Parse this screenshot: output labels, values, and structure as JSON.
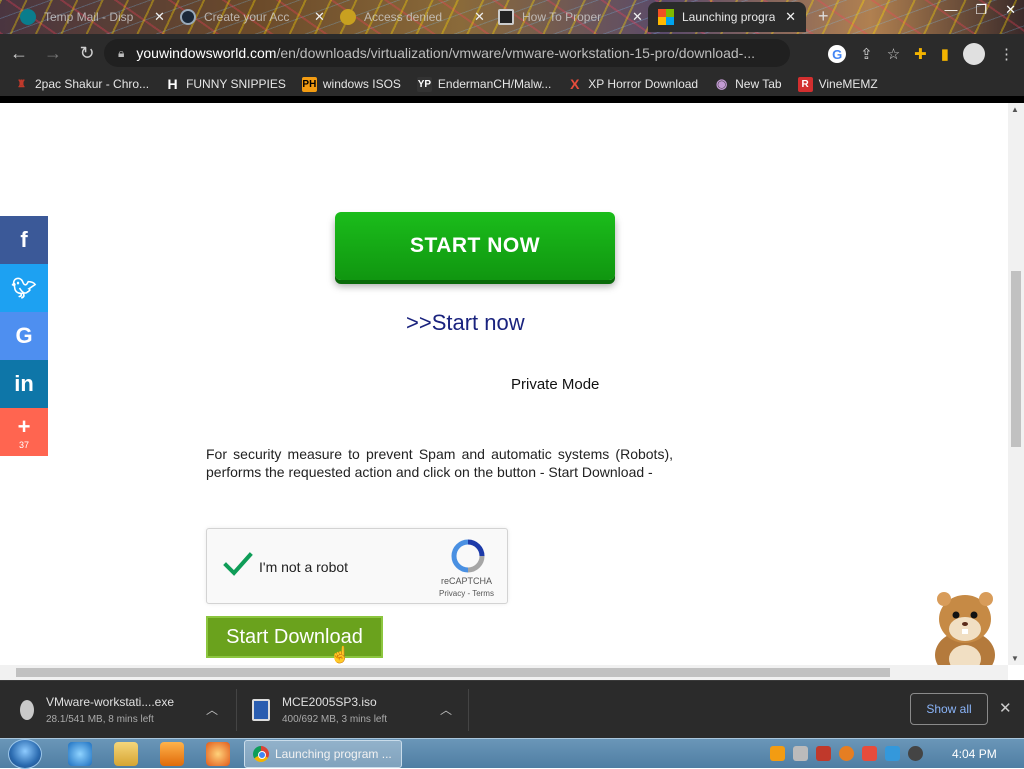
{
  "tabs": [
    {
      "title": "Temp Mail - Disp",
      "favicon_color": "#0a7d8c",
      "active": false
    },
    {
      "title": "Create your Acc",
      "favicon_color": "#1b2838",
      "active": false
    },
    {
      "title": "Access denied",
      "favicon_color": "#c8a020",
      "active": false
    },
    {
      "title": "How To Proper",
      "favicon_color": "#222222",
      "active": false
    },
    {
      "title": "Launching progra",
      "favicon_color": "#f25022",
      "active": true
    }
  ],
  "url": {
    "host": "youwindowsworld.com",
    "path": "/en/downloads/virtualization/vmware/vmware-workstation-15-pro/download-..."
  },
  "bookmarks": [
    {
      "label": "2pac Shakur - Chro...",
      "icon": "gear-icon",
      "color": "#c0392b",
      "glyph": "♜"
    },
    {
      "label": "FUNNY SNIPPIES",
      "icon": "h-logo-icon",
      "color": "#ffffff",
      "glyph": "H"
    },
    {
      "label": "windows ISOS",
      "icon": "ph-logo-icon",
      "color": "#f39c12",
      "glyph": "PH"
    },
    {
      "label": "EndermanCH/Malw...",
      "icon": "yp-logo-icon",
      "color": "#333333",
      "glyph": "YP"
    },
    {
      "label": "XP Horror Download",
      "icon": "x-logo-icon",
      "color": "#e74c3c",
      "glyph": "X"
    },
    {
      "label": "New Tab",
      "icon": "globe-icon",
      "color": "#9b59b6",
      "glyph": "◉"
    },
    {
      "label": "VineMEMZ",
      "icon": "r-logo-icon",
      "color": "#d32f2f",
      "glyph": "R"
    }
  ],
  "social": {
    "plus_count": "37"
  },
  "page": {
    "start_now_button": "START NOW",
    "start_now_link": ">>Start now",
    "private_mode": "Private Mode",
    "security_text": "For security measure to prevent Spam and automatic systems (Robots), performs the requested action and click on the button - Start Download -",
    "recaptcha": {
      "label": "I'm not a robot",
      "brand": "reCAPTCHA",
      "terms": "Privacy - Terms"
    },
    "start_download_button": "Start Download"
  },
  "downloads": [
    {
      "name": "VMware-workstati....exe",
      "status": "28.1/541 MB, 8 mins left",
      "icon_color": "#c9c9c9"
    },
    {
      "name": "MCE2005SP3.iso",
      "status": "400/692 MB, 3 mins left",
      "icon_color": "#2a5db0"
    }
  ],
  "download_bar": {
    "show_all": "Show all"
  },
  "taskbar": {
    "task_label": "Launching program ...",
    "clock": "4:04 PM"
  },
  "colors": {
    "start_green": "#14a814",
    "download_green": "#6aa21d",
    "link_navy": "#1a237e"
  }
}
